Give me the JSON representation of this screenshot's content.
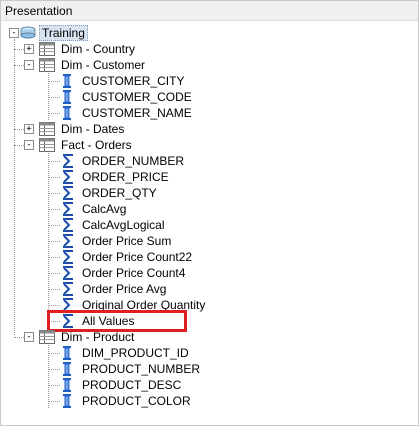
{
  "panel": {
    "title": "Presentation"
  },
  "tree": {
    "root": {
      "label": "Training",
      "expander": "-"
    },
    "folders": [
      {
        "label": "Dim - Country",
        "expander": "+"
      },
      {
        "label": "Dim - Customer",
        "expander": "-",
        "columns": [
          "CUSTOMER_CITY",
          "CUSTOMER_CODE",
          "CUSTOMER_NAME"
        ]
      },
      {
        "label": "Dim - Dates",
        "expander": "+"
      },
      {
        "label": "Fact - Orders",
        "expander": "-",
        "columns": [
          "ORDER_NUMBER",
          "ORDER_PRICE",
          "ORDER_QTY",
          "CalcAvg",
          "CalcAvgLogical",
          "Order Price Sum",
          "Order Price Count22",
          "Order Price Count4",
          "Order Price Avg",
          "Original Order Quantity",
          "All Values"
        ]
      },
      {
        "label": "Dim - Product",
        "expander": "-",
        "columns": [
          "DIM_PRODUCT_ID",
          "PRODUCT_NUMBER",
          "PRODUCT_DESC",
          "PRODUCT_COLOR"
        ]
      }
    ]
  },
  "colors": {
    "highlight": "#e02020",
    "measure_icon": "#1e4fb0",
    "column_icon": "#1e5fc8"
  }
}
